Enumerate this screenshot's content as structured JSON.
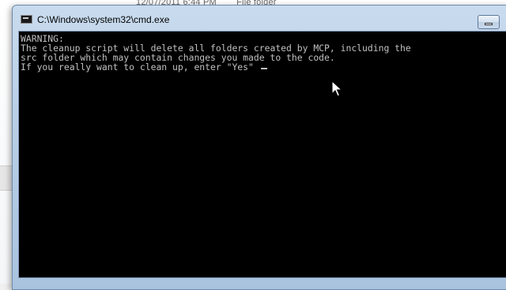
{
  "background": {
    "row_text": [
      "12/07/2011 6:44 PM",
      "File folder"
    ]
  },
  "window": {
    "title": "C:\\Windows\\system32\\cmd.exe"
  },
  "console": {
    "lines": [
      "WARNING:",
      "The cleanup script will delete all folders created by MCP, including the",
      "src folder which may contain changes you made to the code.",
      "If you really want to clean up, enter \"Yes\""
    ]
  },
  "icons": {
    "window_icon": "cmd-icon",
    "pointer": "mouse-pointer-icon",
    "minimize": "minimize-icon"
  }
}
